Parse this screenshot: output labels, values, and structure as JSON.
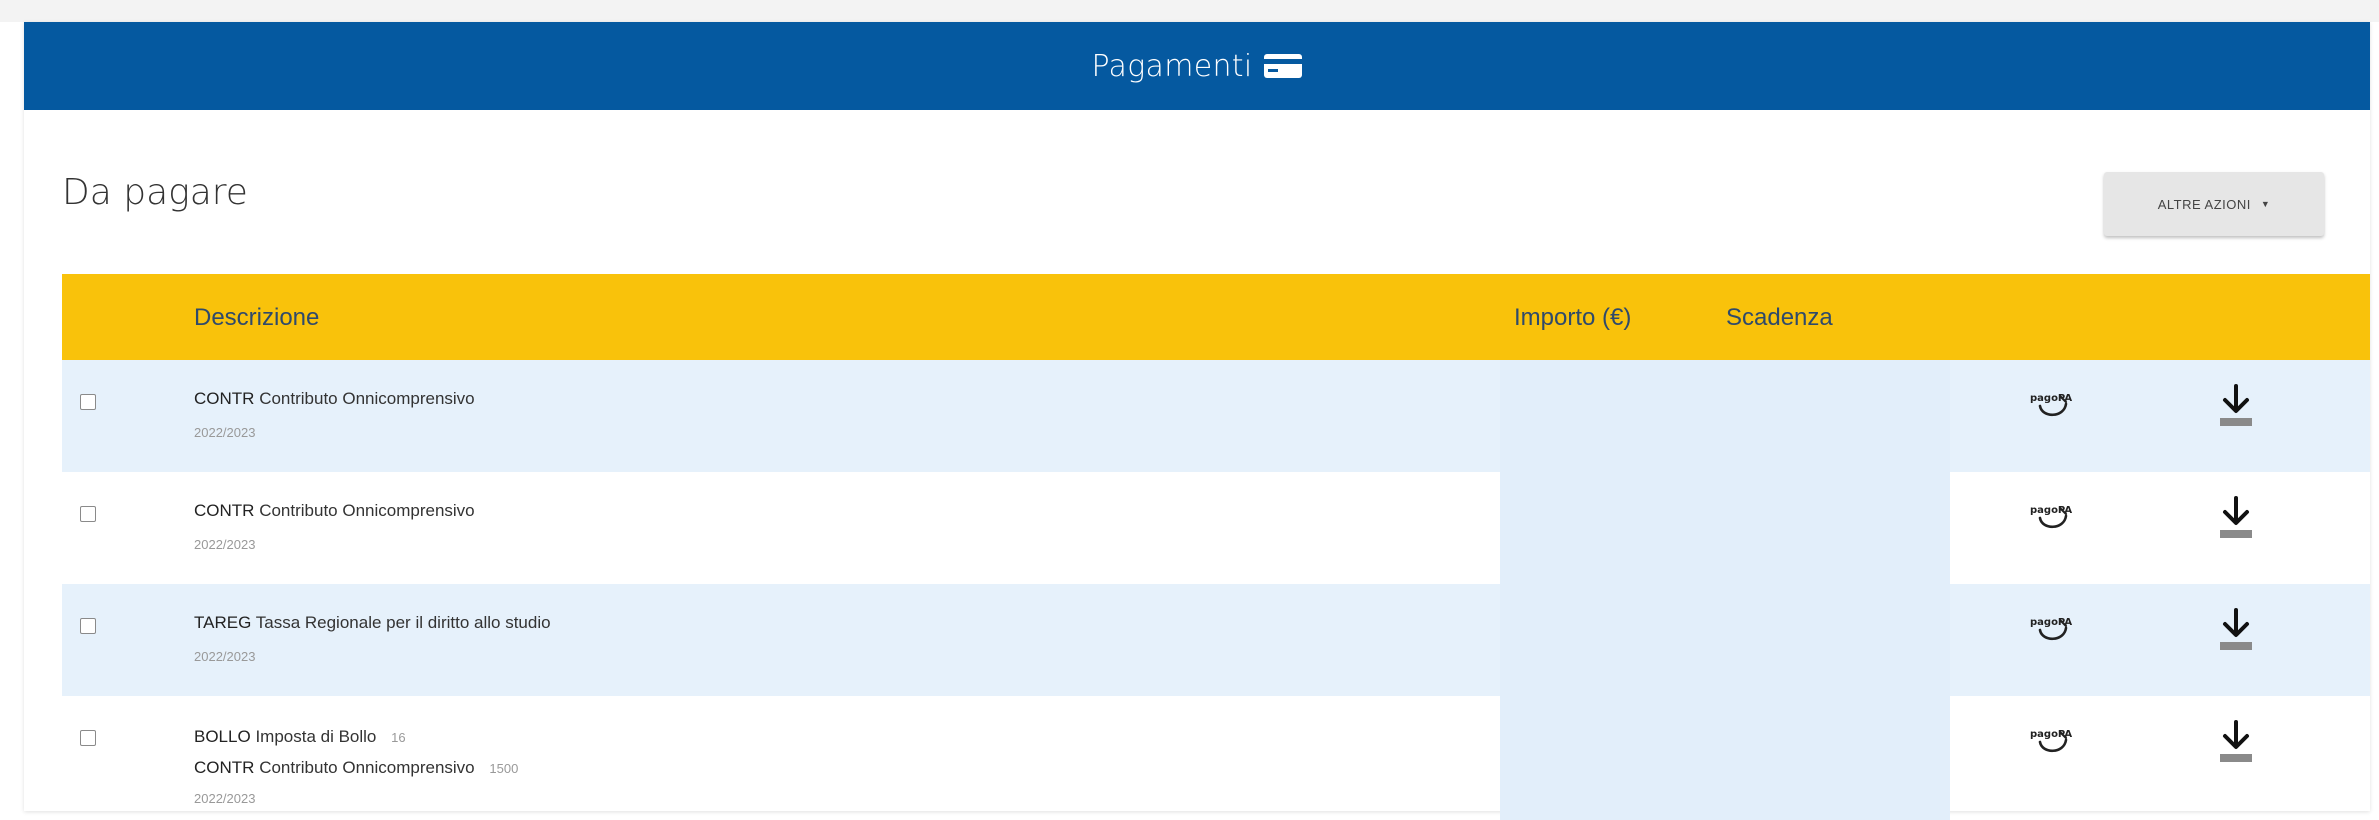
{
  "header": {
    "title": "Pagamenti",
    "icon": "credit-card-icon"
  },
  "section": {
    "title": "Da pagare"
  },
  "actions": {
    "label": "ALTRE AZIONI"
  },
  "table": {
    "columns": [
      "Descrizione",
      "Importo (€)",
      "Scadenza"
    ],
    "rows": [
      {
        "lines": [
          {
            "code": "CONTR",
            "text": "Contributo Onnicomprensivo",
            "amount": ""
          }
        ],
        "year": "2022/2023"
      },
      {
        "lines": [
          {
            "code": "CONTR",
            "text": "Contributo Onnicomprensivo",
            "amount": ""
          }
        ],
        "year": "2022/2023"
      },
      {
        "lines": [
          {
            "code": "TAREG",
            "text": "Tassa Regionale per il diritto allo studio",
            "amount": ""
          }
        ],
        "year": "2022/2023"
      },
      {
        "lines": [
          {
            "code": "BOLLO",
            "text": "Imposta di Bollo",
            "amount": "16"
          },
          {
            "code": "CONTR",
            "text": "Contributo Onnicomprensivo",
            "amount": "1500"
          }
        ],
        "year": "2022/2023"
      }
    ],
    "pay_icon_label": "pagoPA",
    "colors": {
      "header_bg": "#f9c20b",
      "alt_row": "#e6f1fb",
      "brand": "#0559a0"
    }
  }
}
